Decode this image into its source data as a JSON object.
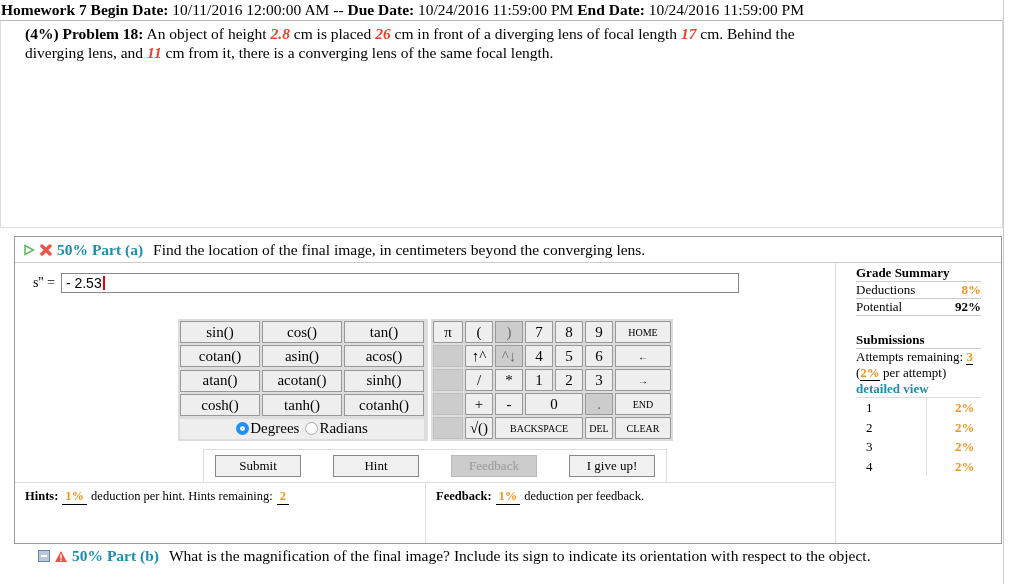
{
  "header": "**Homework 7 Begin Date:** 10/11/2016 12:00:00 AM -- **Due Date:** 10/24/2016 11:59:00 PM **End Date:** 10/24/2016 11:59:00 PM",
  "problem": "**(4%) Problem 18:** An object of height *2.8* cm is placed *26* cm in front of a diverging lens of focal length *17* cm. Behind the diverging lens, and *11* cm from it, there is a converging lens of the same focal length.",
  "parts": [
    {
      "kind": "open",
      "percent": "50% Part (a)",
      "question": "Find the location of the final image, in centimeters beyond the converging lens."
    },
    {
      "kind": "collapsed",
      "percent": "50% Part (b)",
      "question": "What is the magnification of the final image? Include its sign to indicate its orientation with respect to the object."
    }
  ],
  "answer": {
    "label": "s'' =",
    "value": "- 2.53"
  },
  "functions": [
    [
      "sin()",
      "cos()",
      "tan()"
    ],
    [
      "cotan()",
      "asin()",
      "acos()"
    ],
    [
      "atan()",
      "acotan()",
      "sinh()"
    ],
    [
      "cosh()",
      "tanh()",
      "cotanh()"
    ]
  ],
  "angle_modes": [
    {
      "label": "Degrees",
      "selected": true
    },
    {
      "label": "Radians",
      "selected": false
    }
  ],
  "keypad": [
    [
      {
        "kind": "key",
        "label": "π",
        "disabled": false
      },
      {
        "kind": "key",
        "label": "(",
        "disabled": false
      },
      {
        "kind": "key",
        "label": ")",
        "disabled": true
      },
      {
        "kind": "key",
        "label": "7",
        "disabled": false
      },
      {
        "kind": "key",
        "label": "8",
        "disabled": false
      },
      {
        "kind": "key",
        "label": "9",
        "disabled": false
      },
      {
        "kind": "command",
        "label": "HOME",
        "disabled": false
      }
    ],
    [
      {
        "kind": "blank"
      },
      {
        "kind": "key",
        "label": "↑^",
        "disabled": false
      },
      {
        "kind": "key",
        "label": "^↓",
        "disabled": true
      },
      {
        "kind": "key",
        "label": "4",
        "disabled": false
      },
      {
        "kind": "key",
        "label": "5",
        "disabled": false
      },
      {
        "kind": "key",
        "label": "6",
        "disabled": false
      },
      {
        "kind": "command",
        "label": "←",
        "disabled": false
      }
    ],
    [
      {
        "kind": "blank"
      },
      {
        "kind": "key",
        "label": "/",
        "disabled": false
      },
      {
        "kind": "key",
        "label": "*",
        "disabled": false
      },
      {
        "kind": "key",
        "label": "1",
        "disabled": false
      },
      {
        "kind": "key",
        "label": "2",
        "disabled": false
      },
      {
        "kind": "key",
        "label": "3",
        "disabled": false
      },
      {
        "kind": "command",
        "label": "→",
        "disabled": false
      }
    ],
    [
      {
        "kind": "blank"
      },
      {
        "kind": "key",
        "label": "+",
        "disabled": false
      },
      {
        "kind": "key",
        "label": "-",
        "disabled": false
      },
      {
        "kind": "wide",
        "label": "0",
        "disabled": false
      },
      {
        "kind": "key",
        "label": ".",
        "disabled": true
      },
      {
        "kind": "command",
        "label": "END",
        "disabled": false
      }
    ],
    [
      {
        "kind": "blank"
      },
      {
        "kind": "key",
        "label": "√()",
        "disabled": false
      },
      {
        "kind": "wide_command",
        "label": "BACKSPACE",
        "disabled": false
      },
      {
        "kind": "command",
        "label": "DEL",
        "disabled": false
      },
      {
        "kind": "command",
        "label": "CLEAR",
        "disabled": false
      }
    ]
  ],
  "buttons": [
    {
      "label": "Submit",
      "disabled": false
    },
    {
      "label": "Hint",
      "disabled": false
    },
    {
      "label": "Feedback",
      "disabled": true
    },
    {
      "label": "I give up!",
      "disabled": false
    }
  ],
  "hints": {
    "label": "Hints:",
    "deduction": "1%",
    "text": "deduction per hint. Hints remaining:",
    "remaining": "2"
  },
  "feedback": {
    "label": "Feedback:",
    "deduction": "1%",
    "text": "deduction per feedback."
  },
  "grade_summary": {
    "title": "Grade Summary",
    "rows": [
      {
        "label": "Deductions",
        "value": "8%",
        "color": "#f7941d"
      },
      {
        "label": "Potential",
        "value": "92%",
        "color": "#000000"
      }
    ]
  },
  "submissions": {
    "title": "Submissions",
    "attempts_label": "Attempts remaining:",
    "attempts": "3",
    "per_attempt_open": "(",
    "per_attempt": "2%",
    "per_attempt_text": "per attempt)",
    "link": "detailed view",
    "rows": [
      {
        "number": "1",
        "value": "2%"
      },
      {
        "number": "2",
        "value": "2%"
      },
      {
        "number": "3",
        "value": "2%"
      },
      {
        "number": "4",
        "value": "2%"
      }
    ]
  }
}
